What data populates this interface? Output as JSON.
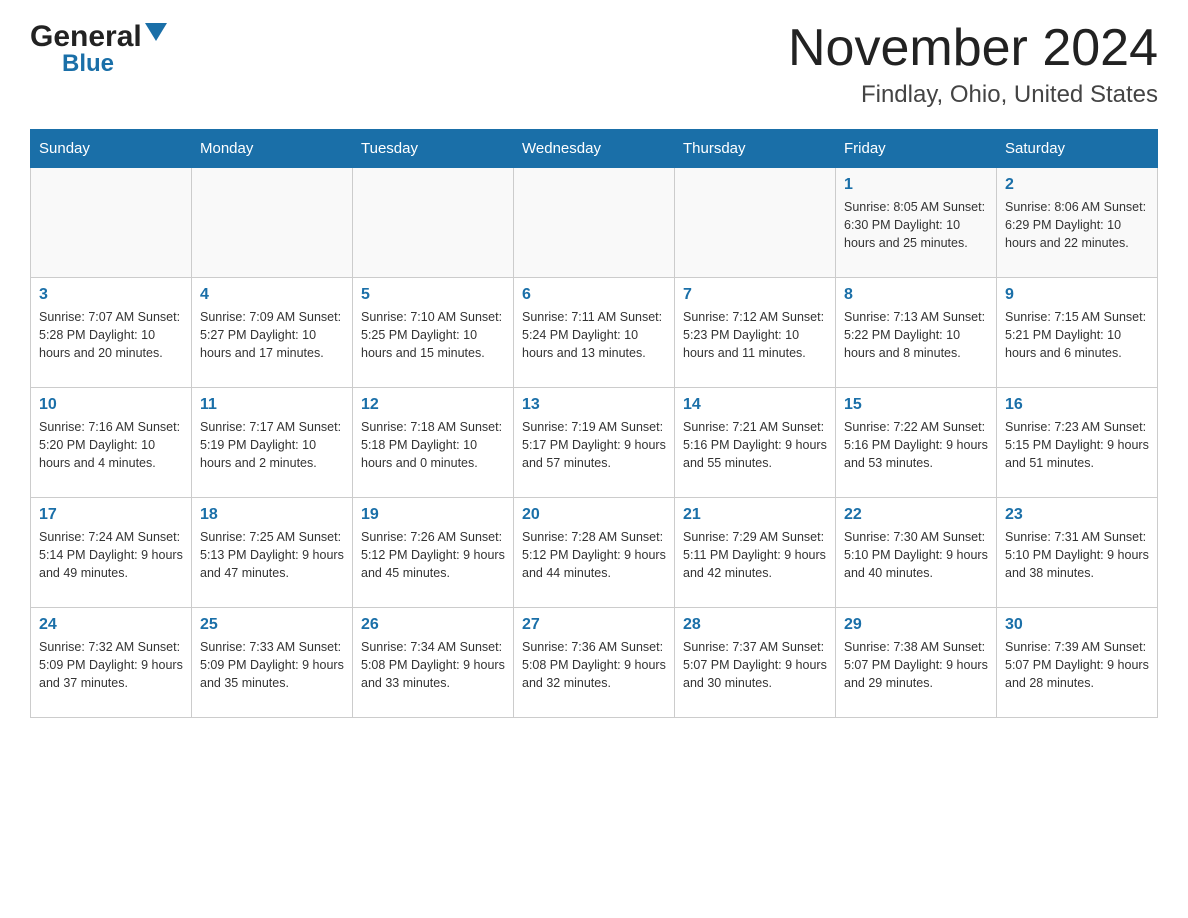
{
  "header": {
    "logo_general": "General",
    "logo_blue": "Blue",
    "month_title": "November 2024",
    "location": "Findlay, Ohio, United States"
  },
  "days_of_week": [
    "Sunday",
    "Monday",
    "Tuesday",
    "Wednesday",
    "Thursday",
    "Friday",
    "Saturday"
  ],
  "weeks": [
    [
      {
        "day": "",
        "info": ""
      },
      {
        "day": "",
        "info": ""
      },
      {
        "day": "",
        "info": ""
      },
      {
        "day": "",
        "info": ""
      },
      {
        "day": "",
        "info": ""
      },
      {
        "day": "1",
        "info": "Sunrise: 8:05 AM\nSunset: 6:30 PM\nDaylight: 10 hours\nand 25 minutes."
      },
      {
        "day": "2",
        "info": "Sunrise: 8:06 AM\nSunset: 6:29 PM\nDaylight: 10 hours\nand 22 minutes."
      }
    ],
    [
      {
        "day": "3",
        "info": "Sunrise: 7:07 AM\nSunset: 5:28 PM\nDaylight: 10 hours\nand 20 minutes."
      },
      {
        "day": "4",
        "info": "Sunrise: 7:09 AM\nSunset: 5:27 PM\nDaylight: 10 hours\nand 17 minutes."
      },
      {
        "day": "5",
        "info": "Sunrise: 7:10 AM\nSunset: 5:25 PM\nDaylight: 10 hours\nand 15 minutes."
      },
      {
        "day": "6",
        "info": "Sunrise: 7:11 AM\nSunset: 5:24 PM\nDaylight: 10 hours\nand 13 minutes."
      },
      {
        "day": "7",
        "info": "Sunrise: 7:12 AM\nSunset: 5:23 PM\nDaylight: 10 hours\nand 11 minutes."
      },
      {
        "day": "8",
        "info": "Sunrise: 7:13 AM\nSunset: 5:22 PM\nDaylight: 10 hours\nand 8 minutes."
      },
      {
        "day": "9",
        "info": "Sunrise: 7:15 AM\nSunset: 5:21 PM\nDaylight: 10 hours\nand 6 minutes."
      }
    ],
    [
      {
        "day": "10",
        "info": "Sunrise: 7:16 AM\nSunset: 5:20 PM\nDaylight: 10 hours\nand 4 minutes."
      },
      {
        "day": "11",
        "info": "Sunrise: 7:17 AM\nSunset: 5:19 PM\nDaylight: 10 hours\nand 2 minutes."
      },
      {
        "day": "12",
        "info": "Sunrise: 7:18 AM\nSunset: 5:18 PM\nDaylight: 10 hours\nand 0 minutes."
      },
      {
        "day": "13",
        "info": "Sunrise: 7:19 AM\nSunset: 5:17 PM\nDaylight: 9 hours\nand 57 minutes."
      },
      {
        "day": "14",
        "info": "Sunrise: 7:21 AM\nSunset: 5:16 PM\nDaylight: 9 hours\nand 55 minutes."
      },
      {
        "day": "15",
        "info": "Sunrise: 7:22 AM\nSunset: 5:16 PM\nDaylight: 9 hours\nand 53 minutes."
      },
      {
        "day": "16",
        "info": "Sunrise: 7:23 AM\nSunset: 5:15 PM\nDaylight: 9 hours\nand 51 minutes."
      }
    ],
    [
      {
        "day": "17",
        "info": "Sunrise: 7:24 AM\nSunset: 5:14 PM\nDaylight: 9 hours\nand 49 minutes."
      },
      {
        "day": "18",
        "info": "Sunrise: 7:25 AM\nSunset: 5:13 PM\nDaylight: 9 hours\nand 47 minutes."
      },
      {
        "day": "19",
        "info": "Sunrise: 7:26 AM\nSunset: 5:12 PM\nDaylight: 9 hours\nand 45 minutes."
      },
      {
        "day": "20",
        "info": "Sunrise: 7:28 AM\nSunset: 5:12 PM\nDaylight: 9 hours\nand 44 minutes."
      },
      {
        "day": "21",
        "info": "Sunrise: 7:29 AM\nSunset: 5:11 PM\nDaylight: 9 hours\nand 42 minutes."
      },
      {
        "day": "22",
        "info": "Sunrise: 7:30 AM\nSunset: 5:10 PM\nDaylight: 9 hours\nand 40 minutes."
      },
      {
        "day": "23",
        "info": "Sunrise: 7:31 AM\nSunset: 5:10 PM\nDaylight: 9 hours\nand 38 minutes."
      }
    ],
    [
      {
        "day": "24",
        "info": "Sunrise: 7:32 AM\nSunset: 5:09 PM\nDaylight: 9 hours\nand 37 minutes."
      },
      {
        "day": "25",
        "info": "Sunrise: 7:33 AM\nSunset: 5:09 PM\nDaylight: 9 hours\nand 35 minutes."
      },
      {
        "day": "26",
        "info": "Sunrise: 7:34 AM\nSunset: 5:08 PM\nDaylight: 9 hours\nand 33 minutes."
      },
      {
        "day": "27",
        "info": "Sunrise: 7:36 AM\nSunset: 5:08 PM\nDaylight: 9 hours\nand 32 minutes."
      },
      {
        "day": "28",
        "info": "Sunrise: 7:37 AM\nSunset: 5:07 PM\nDaylight: 9 hours\nand 30 minutes."
      },
      {
        "day": "29",
        "info": "Sunrise: 7:38 AM\nSunset: 5:07 PM\nDaylight: 9 hours\nand 29 minutes."
      },
      {
        "day": "30",
        "info": "Sunrise: 7:39 AM\nSunset: 5:07 PM\nDaylight: 9 hours\nand 28 minutes."
      }
    ]
  ]
}
